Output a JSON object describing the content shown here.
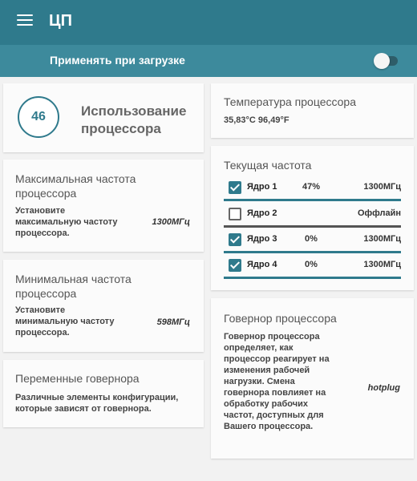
{
  "app": {
    "title": "ЦП"
  },
  "apply_on_boot": {
    "label": "Применять при загрузке",
    "enabled": false
  },
  "cpu_usage": {
    "value": "46",
    "title": "Использование процессора"
  },
  "max_freq": {
    "title": "Максимальная частота процессора",
    "desc": "Установите максимальную частоту процессора.",
    "value": "1300МГц"
  },
  "min_freq": {
    "title": "Минимальная частота процессора",
    "desc": "Установите минимальную частоту процессора.",
    "value": "598МГц"
  },
  "gov_vars": {
    "title": "Переменные говернора",
    "desc": "Различные элементы конфигурации, которые зависят от говернора."
  },
  "temperature": {
    "title": "Температура процессора",
    "value": "35,83°C 96,49°F"
  },
  "current_freq": {
    "title": "Текущая частота",
    "cores": [
      {
        "name": "Ядро 1",
        "load": "47%",
        "freq": "1300МГц",
        "checked": true
      },
      {
        "name": "Ядро 2",
        "load": "",
        "freq": "Оффлайн",
        "checked": false
      },
      {
        "name": "Ядро 3",
        "load": "0%",
        "freq": "1300МГц",
        "checked": true
      },
      {
        "name": "Ядро 4",
        "load": "0%",
        "freq": "1300МГц",
        "checked": true
      }
    ]
  },
  "governor": {
    "title": "Говернор процессора",
    "desc": "Говернор процессора определяет, как процессор реагирует на изменения рабочей нагрузки. Смена говернора повлияет на обработку рабочих частот, доступных для Вашего процессора.",
    "value": "hotplug"
  },
  "colors": {
    "primary": "#2f7a8c",
    "secondary": "#3d8a9c",
    "offline_bar": "#555555"
  }
}
